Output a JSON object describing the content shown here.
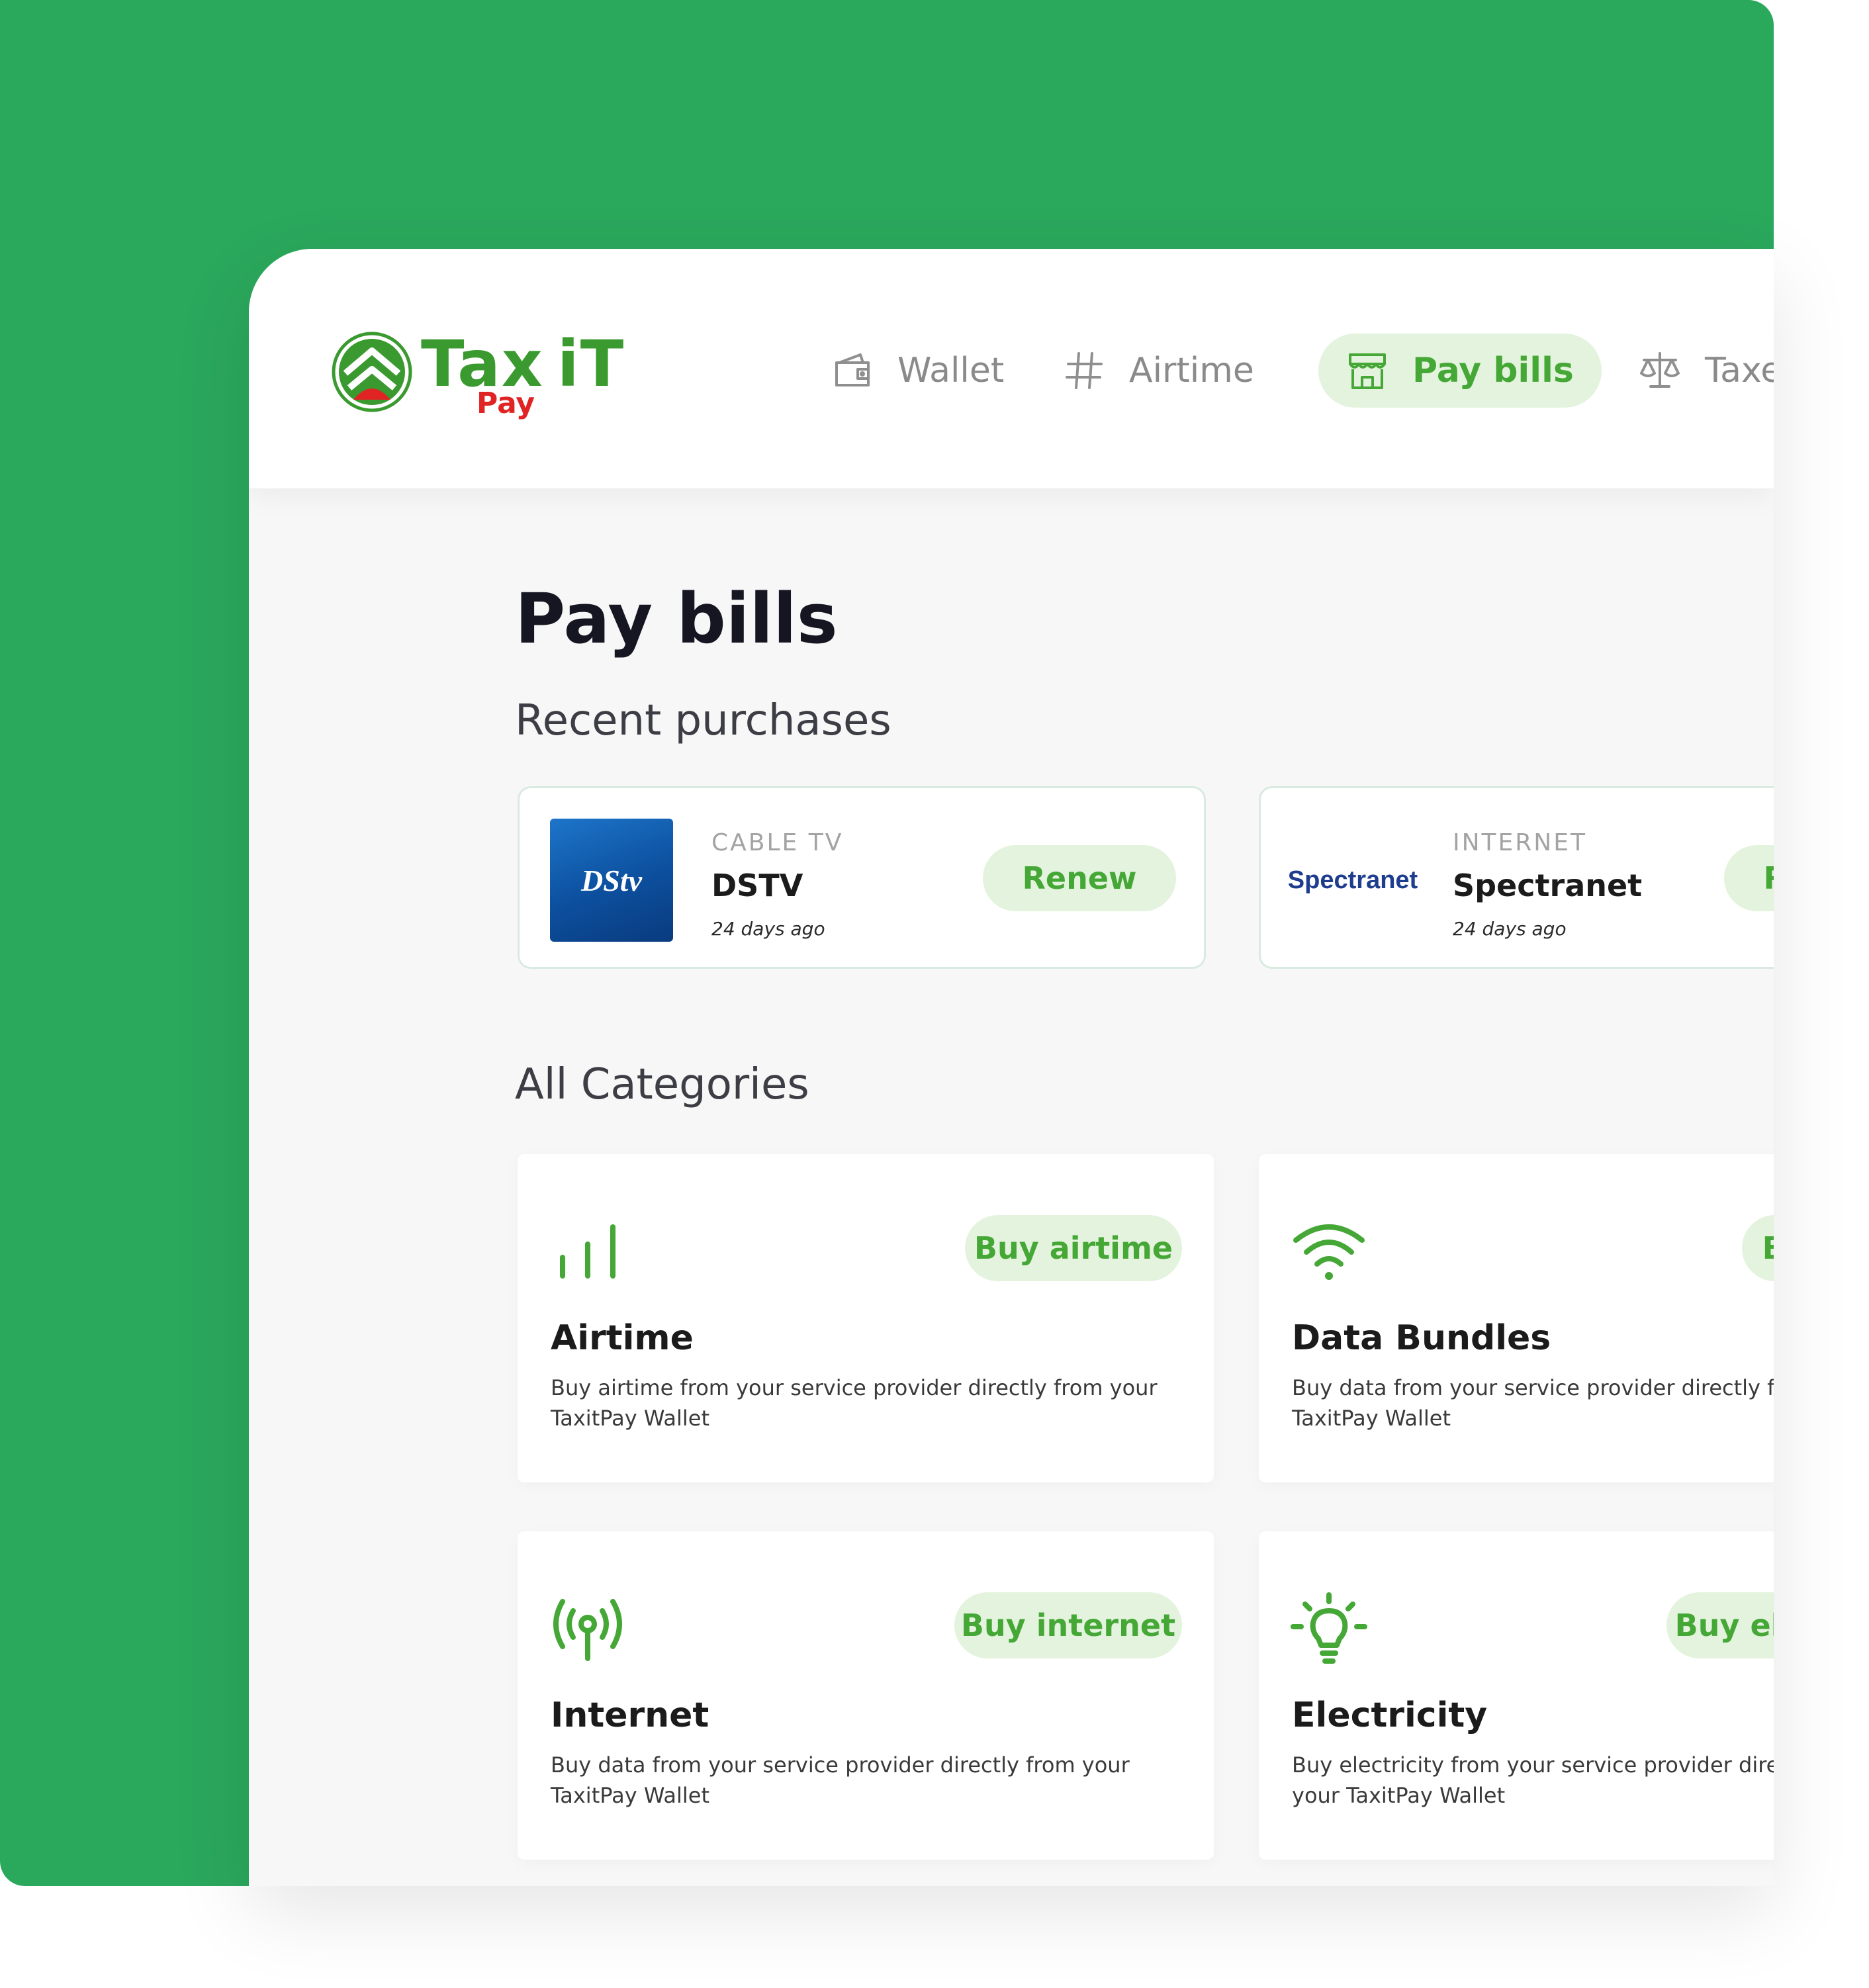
{
  "brand": {
    "name_part1": "Tax",
    "name_part2": "iT",
    "sub": "Pay"
  },
  "nav": [
    {
      "label": "Wallet",
      "icon": "wallet-icon",
      "active": false
    },
    {
      "label": "Airtime",
      "icon": "hash-icon",
      "active": false
    },
    {
      "label": "Pay bills",
      "icon": "store-icon",
      "active": true
    },
    {
      "label": "Taxes",
      "icon": "scale-icon",
      "active": false
    }
  ],
  "page": {
    "title": "Pay bills",
    "recent_title": "Recent purchases",
    "categories_title": "All Categories"
  },
  "recent": [
    {
      "logo_text": "DStv",
      "category": "CABLE TV",
      "name": "DSTV",
      "time": "24 days ago",
      "action": "Renew"
    },
    {
      "logo_text": "Spectranet",
      "category": "INTERNET",
      "name": "Spectranet",
      "time": "24 days ago",
      "action": "Renew"
    }
  ],
  "categories": [
    {
      "icon": "signal-bars-icon",
      "title": "Airtime",
      "desc": "Buy airtime from your service provider directly from your TaxitPay Wallet",
      "action": "Buy airtime"
    },
    {
      "icon": "wifi-icon",
      "title": "Data Bundles",
      "desc": "Buy data from your service provider directly from your TaxitPay Wallet",
      "action": "Buy data"
    },
    {
      "icon": "broadcast-antenna-icon",
      "title": "Internet",
      "desc": "Buy data from your service provider directly from your TaxitPay Wallet",
      "action": "Buy internet"
    },
    {
      "icon": "lightbulb-icon",
      "title": "Electricity",
      "desc": "Buy electricity from your service provider directly from your TaxitPay Wallet",
      "action": "Buy electricity"
    }
  ],
  "colors": {
    "background": "#2aa85c",
    "accent": "#45a836",
    "accent_soft": "#e4f3dd",
    "logo_red": "#e02424"
  }
}
